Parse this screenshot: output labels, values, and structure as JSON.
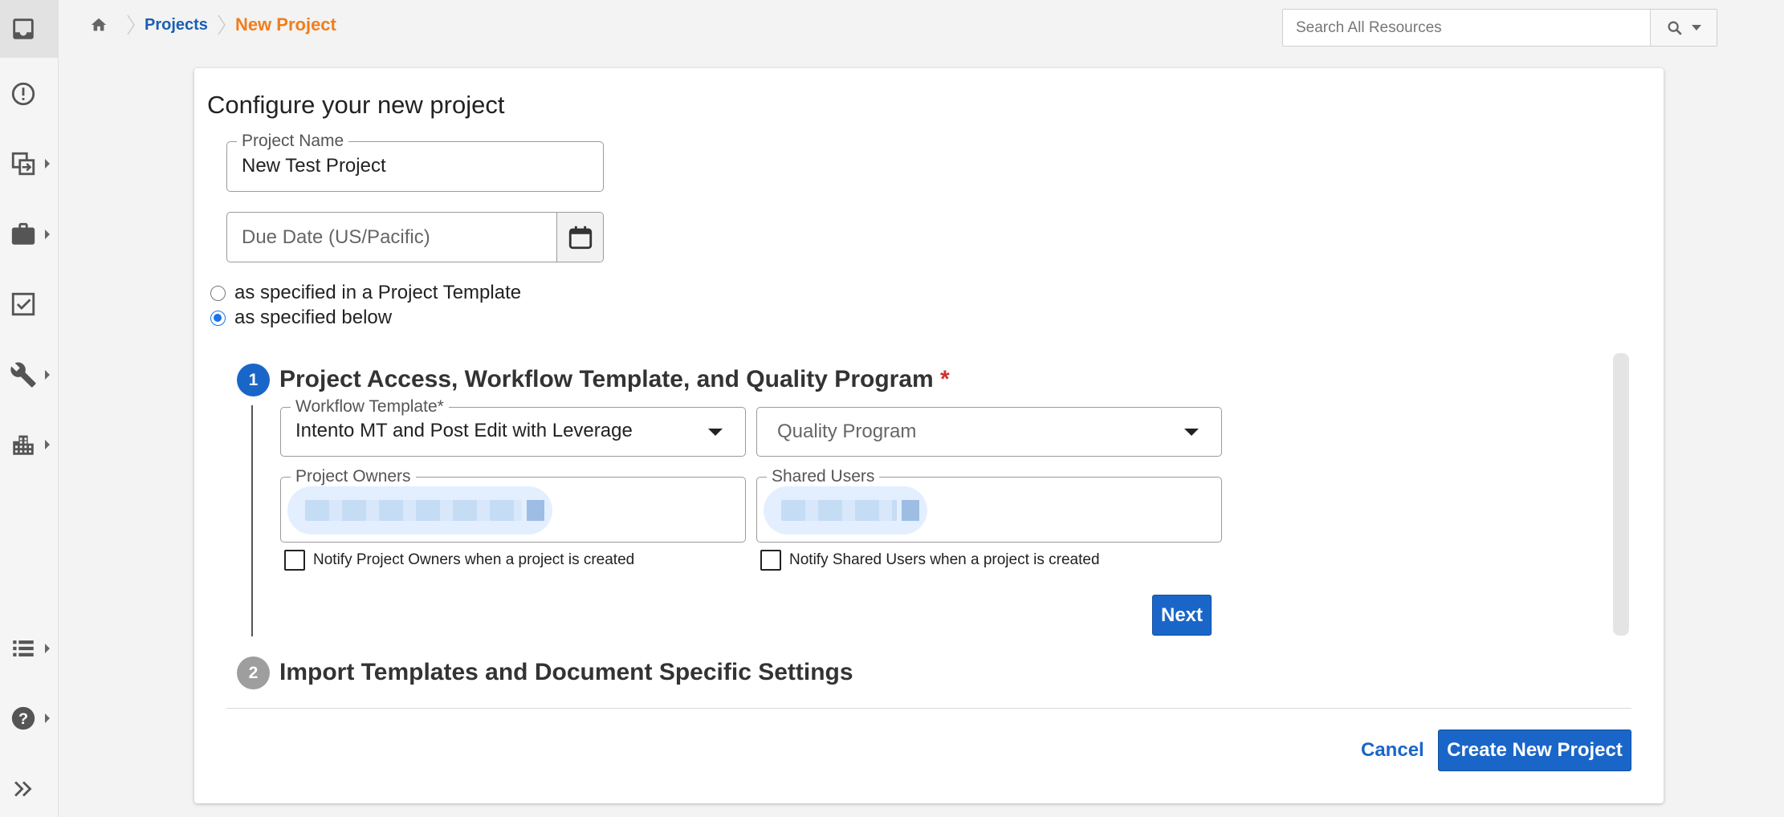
{
  "breadcrumb": {
    "projects": "Projects",
    "current": "New Project"
  },
  "search": {
    "placeholder": "Search All Resources"
  },
  "sidebar": {
    "items": [
      {
        "icon": "inbox-icon"
      },
      {
        "icon": "alert-circle-icon"
      },
      {
        "icon": "transfer-icon"
      },
      {
        "icon": "briefcase-icon"
      },
      {
        "icon": "checkbox-icon"
      },
      {
        "icon": "wrench-icon"
      },
      {
        "icon": "building-icon"
      },
      {
        "icon": "list-icon"
      },
      {
        "icon": "help-icon"
      },
      {
        "icon": "expand-icon"
      }
    ]
  },
  "form": {
    "title": "Configure your new project",
    "project_name_label": "Project Name",
    "project_name_value": "New Test Project",
    "due_date_placeholder": "Due Date (US/Pacific)",
    "radio_template": "as specified in a Project Template",
    "radio_below": "as specified below",
    "selected_option": "as specified below"
  },
  "step1": {
    "number": "1",
    "title": "Project Access, Workflow Template, and Quality Program",
    "required_mark": "*",
    "workflow_label": "Workflow Template*",
    "workflow_value": "Intento MT and Post Edit with Leverage",
    "quality_placeholder": "Quality Program",
    "owners_label": "Project Owners",
    "shared_label": "Shared Users",
    "notify_owners": "Notify Project Owners when a project is created",
    "notify_shared": "Notify Shared Users when a project is created",
    "next_label": "Next"
  },
  "step2": {
    "number": "2",
    "title": "Import Templates and Document Specific Settings"
  },
  "footer": {
    "cancel_label": "Cancel",
    "create_label": "Create New Project"
  },
  "colors": {
    "primary": "#1a66c8",
    "breadcrumb_current": "#f07e1c",
    "required": "#d32f2f",
    "step_active": "#1a66c8",
    "step_inactive": "#9e9e9e"
  }
}
